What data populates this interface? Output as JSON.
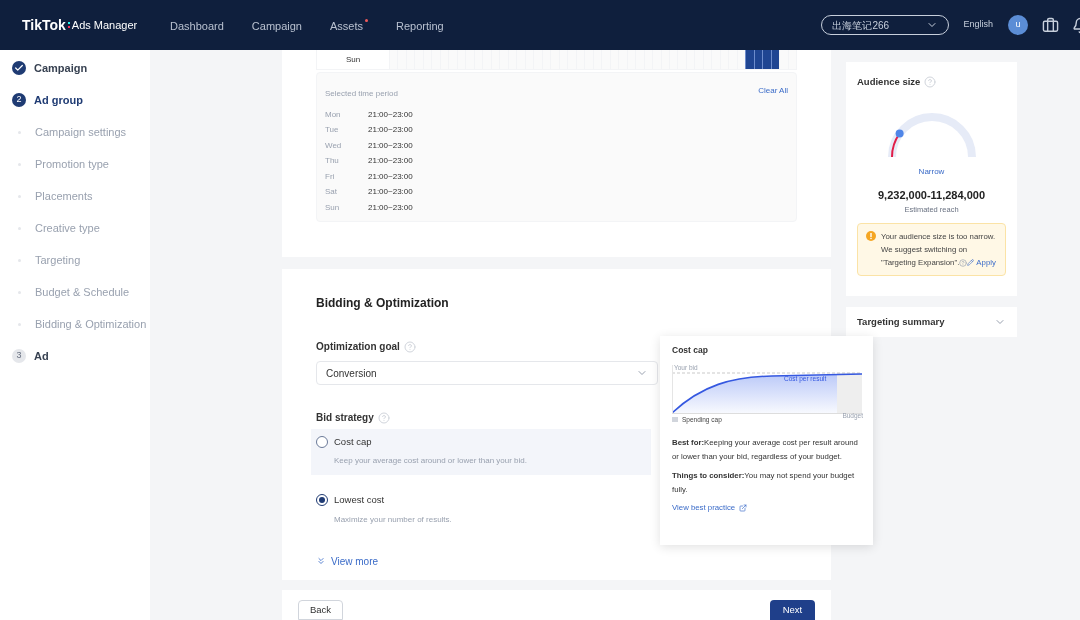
{
  "header": {
    "logo": {
      "brand": "TikTok",
      "product": "Ads Manager"
    },
    "nav": [
      {
        "label": "Dashboard",
        "badge": false
      },
      {
        "label": "Campaign",
        "badge": false
      },
      {
        "label": "Assets",
        "badge": true
      },
      {
        "label": "Reporting",
        "badge": false
      }
    ],
    "account": "出海笔记266",
    "language": "English",
    "avatar": "u"
  },
  "sidebar": {
    "steps": [
      {
        "kind": "done",
        "label": "Campaign"
      },
      {
        "kind": "current",
        "number": "2",
        "label": "Ad group"
      },
      {
        "kind": "substep",
        "label": "Campaign settings"
      },
      {
        "kind": "substep",
        "label": "Promotion type"
      },
      {
        "kind": "substep",
        "label": "Placements"
      },
      {
        "kind": "substep",
        "label": "Creative type"
      },
      {
        "kind": "substep",
        "label": "Targeting"
      },
      {
        "kind": "substep",
        "label": "Budget & Schedule"
      },
      {
        "kind": "substep",
        "label": "Bidding & Optimization"
      },
      {
        "kind": "pending",
        "number": "3",
        "label": "Ad"
      }
    ]
  },
  "schedule": {
    "grid_row": {
      "label": "Sun",
      "cells": [
        {
          "selected": false
        },
        {
          "selected": false
        },
        {
          "selected": false
        },
        {
          "selected": false
        },
        {
          "selected": false
        },
        {
          "selected": false
        },
        {
          "selected": false
        },
        {
          "selected": false
        },
        {
          "selected": false
        },
        {
          "selected": false
        },
        {
          "selected": false
        },
        {
          "selected": false
        },
        {
          "selected": false
        },
        {
          "selected": false
        },
        {
          "selected": false
        },
        {
          "selected": false
        },
        {
          "selected": false
        },
        {
          "selected": false
        },
        {
          "selected": false
        },
        {
          "selected": false
        },
        {
          "selected": false
        },
        {
          "selected": false
        },
        {
          "selected": false
        },
        {
          "selected": false
        },
        {
          "selected": false
        },
        {
          "selected": false
        },
        {
          "selected": false
        },
        {
          "selected": false
        },
        {
          "selected": false
        },
        {
          "selected": false
        },
        {
          "selected": false
        },
        {
          "selected": false
        },
        {
          "selected": false
        },
        {
          "selected": false
        },
        {
          "selected": false
        },
        {
          "selected": false
        },
        {
          "selected": false
        },
        {
          "selected": false
        },
        {
          "selected": false
        },
        {
          "selected": false
        },
        {
          "selected": false
        },
        {
          "selected": false
        },
        {
          "selected": true
        },
        {
          "selected": true
        },
        {
          "selected": true
        },
        {
          "selected": true
        },
        {
          "selected": false
        },
        {
          "selected": false
        }
      ]
    },
    "selected_title": "Selected time period",
    "clear": "Clear All",
    "periods": [
      {
        "day": "Mon",
        "time": "21:00~23:00"
      },
      {
        "day": "Tue",
        "time": "21:00~23:00"
      },
      {
        "day": "Wed",
        "time": "21:00~23:00"
      },
      {
        "day": "Thu",
        "time": "21:00~23:00"
      },
      {
        "day": "Fri",
        "time": "21:00~23:00"
      },
      {
        "day": "Sat",
        "time": "21:00~23:00"
      },
      {
        "day": "Sun",
        "time": "21:00~23:00"
      }
    ]
  },
  "bidding": {
    "title": "Bidding & Optimization",
    "goal_label": "Optimization goal",
    "goal_value": "Conversion",
    "strategy_label": "Bid strategy",
    "options": [
      {
        "label": "Cost cap",
        "description": "Keep your average cost around or lower than your bid.",
        "selected": false,
        "highlighted": true
      },
      {
        "label": "Lowest cost",
        "description": "Maximize your number of results.",
        "selected": true,
        "highlighted": false
      }
    ],
    "view_more": "View more"
  },
  "popover": {
    "title": "Cost cap",
    "chart_labels": {
      "your_bid": "Your bid",
      "cost_per_result": "Cost per result",
      "spending_cap": "Spending cap",
      "budget": "Budget"
    },
    "best_for": "**Best for:**Keeping your average cost per result around or lower than your bid, regardless of your budget.",
    "consider": "**Things to consider:**You may not spend your budget fully.",
    "link": "View best practice"
  },
  "footer": {
    "back": "Back",
    "next": "Next"
  },
  "audience": {
    "title": "Audience size",
    "status": "Narrow",
    "range": "9,232,000-11,284,000",
    "caption": "Estimated reach",
    "warning": "Your audience size is too narrow. We suggest switching on \"Targeting Expansion\".",
    "apply": "Apply"
  },
  "targeting_summary": {
    "title": "Targeting summary",
    "expanded": false
  }
}
